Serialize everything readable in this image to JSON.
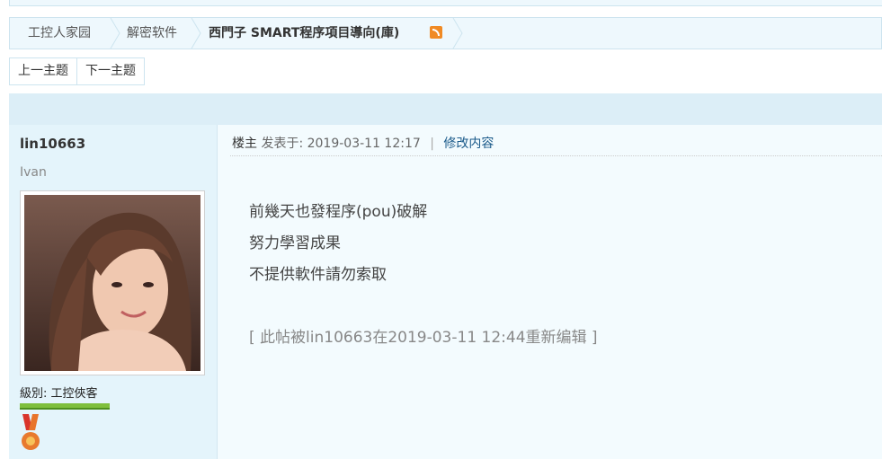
{
  "breadcrumb": {
    "items": [
      "工控人家园",
      "解密软件",
      "西門子 SMART程序項目導向(庫)"
    ]
  },
  "nav": {
    "prev": "上一主题",
    "next": "下一主题"
  },
  "author": {
    "name": "lin10663",
    "subtitle": "Ivan",
    "rank": "級別: 工控俠客"
  },
  "post": {
    "role": "楼主",
    "posted": "发表于: 2019-03-11 12:17",
    "edit_link": "修改内容",
    "lines": [
      "前幾天也發程序(pou)破解",
      "努力學習成果",
      "不提供軟件請勿索取"
    ],
    "edit_note": "[ 此帖被lin10663在2019-03-11 12:44重新编辑 ]"
  },
  "icons": {
    "rss": "rss-icon",
    "medal": "medal-icon"
  },
  "colors": {
    "accent_bg": "#eef8fd",
    "sidebar_bg": "#e4f4fb",
    "link": "#1a5a8a"
  }
}
